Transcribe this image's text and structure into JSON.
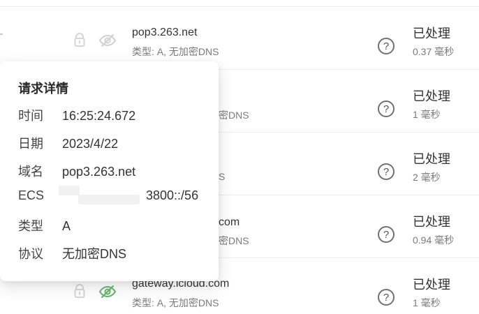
{
  "rows": [
    {
      "domain": "pop3.263.net",
      "sub": "类型: A, 无加密DNS",
      "status": "已处理",
      "time": "0.37 毫秒",
      "lock_icon": "lock-icon",
      "eye_icon": "eye-slash-icon",
      "help_icon": "help-icon",
      "eye_color": "#d0d0d0"
    },
    {
      "domain": "",
      "sub": "密DNS",
      "status": "已处理",
      "time": "1 毫秒",
      "lock_icon": "",
      "eye_icon": "",
      "help_icon": "help-icon",
      "eye_color": "#d0d0d0"
    },
    {
      "domain": "",
      "sub": "S",
      "status": "已处理",
      "time": "2 毫秒",
      "lock_icon": "",
      "eye_icon": "",
      "help_icon": "help-icon",
      "eye_color": "#d0d0d0"
    },
    {
      "domain": "com",
      "sub": "密DNS",
      "status": "已处理",
      "time": "0.94 毫秒",
      "lock_icon": "",
      "eye_icon": "",
      "help_icon": "help-icon",
      "eye_color": "#d0d0d0"
    },
    {
      "domain": "gateway.icloud.com",
      "sub": "类型: A, 无加密DNS",
      "status": "已处理",
      "time": "1 毫秒",
      "lock_icon": "lock-icon",
      "eye_icon": "eye-slash-icon",
      "help_icon": "help-icon",
      "eye_color": "#66b46c"
    }
  ],
  "popover": {
    "title": "请求详情",
    "fields": [
      {
        "k": "时间",
        "v": "16:25:24.672"
      },
      {
        "k": "日期",
        "v": "2023/4/22"
      },
      {
        "k": "域名",
        "v": "pop3.263.net"
      },
      {
        "k": "ECS",
        "v": "3800::/56"
      },
      {
        "k": "类型",
        "v": "A"
      },
      {
        "k": "协议",
        "v": "无加密DNS"
      }
    ]
  }
}
